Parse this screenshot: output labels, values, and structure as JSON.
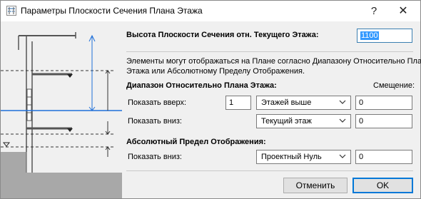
{
  "window": {
    "title": "Параметры Плоскости Сечения Плана Этажа",
    "help_glyph": "?",
    "close_glyph": "✕"
  },
  "cut_height": {
    "label": "Высота Плоскости Сечения отн. Текущего Этажа:",
    "value": "1100"
  },
  "description": {
    "line1": "Элементы могут отображаться на Плане согласно Диапазону Относительно Плана",
    "line2": "Этажа или Абсолютному Пределу Отображения."
  },
  "relative_range": {
    "heading": "Диапазон Относительно Плана Этажа:",
    "offset_header": "Смещение:",
    "show_up": {
      "label": "Показать вверх:",
      "count": "1",
      "story": "Этажей выше",
      "offset": "0"
    },
    "show_down": {
      "label": "Показать вниз:",
      "story": "Текущий этаж",
      "offset": "0"
    }
  },
  "absolute_limit": {
    "heading": "Абсолютный Предел Отображения:",
    "show_down": {
      "label": "Показать вниз:",
      "reference": "Проектный Нуль",
      "offset": "0"
    }
  },
  "buttons": {
    "cancel": "Отменить",
    "ok": "OK"
  },
  "colors": {
    "accent_blue": "#1e6fd9",
    "selection": "#3399ff",
    "ground": "#a8a8a8"
  }
}
